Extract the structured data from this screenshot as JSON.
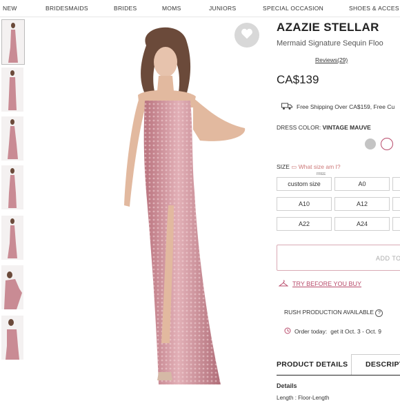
{
  "nav": [
    "NEW",
    "BRIDESMAIDS",
    "BRIDES",
    "MOMS",
    "JUNIORS",
    "SPECIAL OCCASION",
    "SHOES & ACCES"
  ],
  "product": {
    "brand": "AZAZIE STELLAR",
    "subtitle": "Mermaid Signature Sequin Floo",
    "reviews": "Reviews(29)",
    "price": "CA$139",
    "shipping": "Free Shipping Over CA$159, Free Cu",
    "color_label": "DRESS COLOR:",
    "color_value": "VINTAGE MAUVE",
    "size_label": "SIZE",
    "size_link": "What size am I?",
    "free_tag": "FREE",
    "sizes": [
      "custom size",
      "A0",
      "A10",
      "A12",
      "A22",
      "A24"
    ],
    "add_to_bag": "ADD TO",
    "try_before": "TRY BEFORE YOU BUY",
    "rush": "RUSH PRODUCTION AVAILABLE",
    "order_label": "Order today:",
    "order_value": "get it Oct. 3 - Oct. 9",
    "tab_details": "PRODUCT DETAILS",
    "tab_desc": "DESCRIPT",
    "details_heading": "Details",
    "details_line": "Length : Floor-Length"
  },
  "colors": {
    "accent": "#b84b6b",
    "swatch_grey": "#c4c4c4",
    "swatch_mauve": "#e8c9cc",
    "dress": "#c98b94"
  },
  "icons": [
    "heart-icon",
    "truck-icon",
    "hanger-icon",
    "help-icon",
    "clock-icon",
    "measure-icon"
  ]
}
